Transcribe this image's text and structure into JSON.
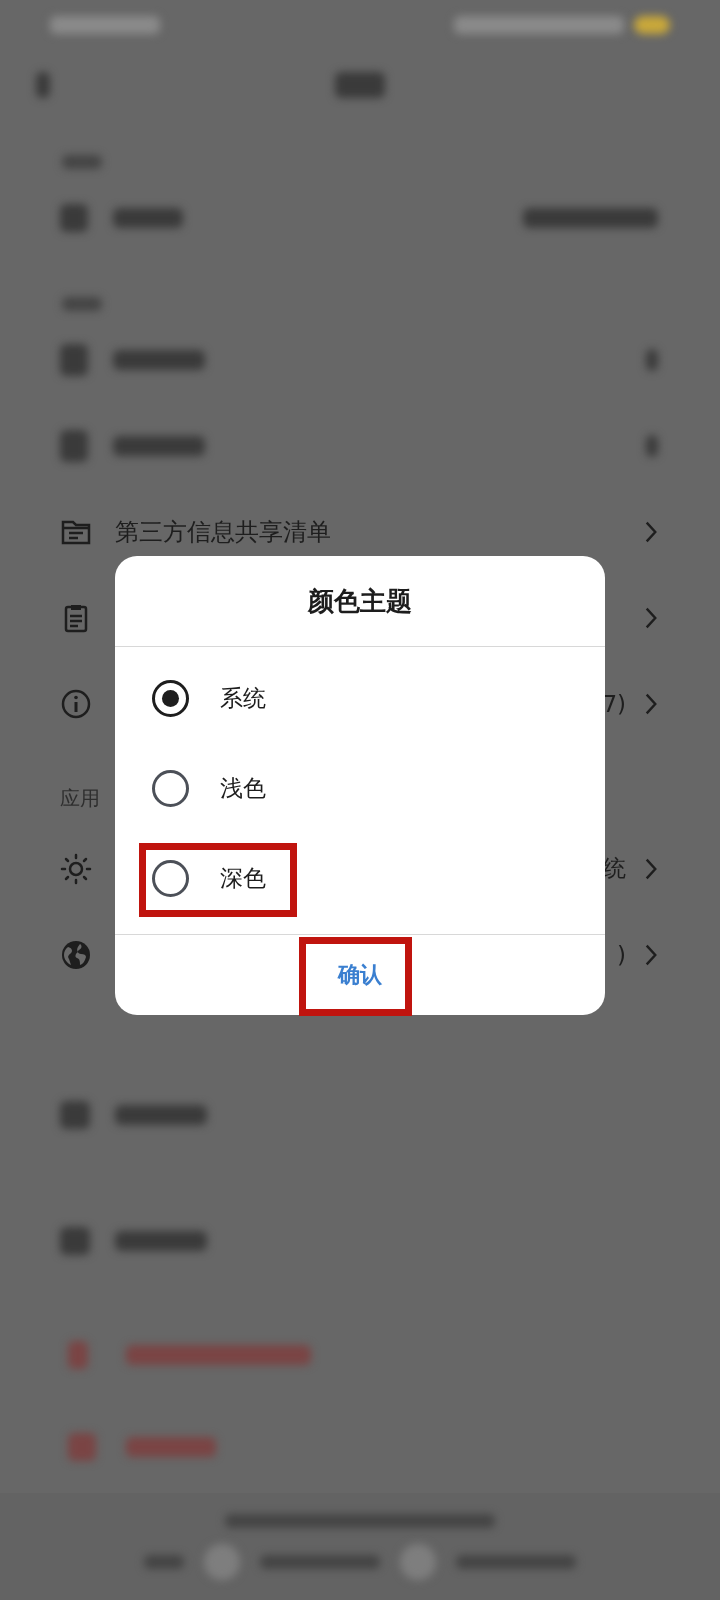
{
  "settings": [
    {
      "kind": "row",
      "label": "第三方信息共享清单"
    },
    {
      "kind": "row"
    },
    {
      "kind": "row",
      "value": "7)"
    },
    {
      "kind": "section",
      "label": "应用"
    },
    {
      "kind": "row",
      "value": "统"
    },
    {
      "kind": "row",
      "value": ")"
    }
  ],
  "dialog": {
    "title": "颜色主题",
    "options": [
      {
        "label": "系统",
        "selected": true
      },
      {
        "label": "浅色",
        "selected": false
      },
      {
        "label": "深色",
        "selected": false
      }
    ],
    "confirm": "确认"
  }
}
